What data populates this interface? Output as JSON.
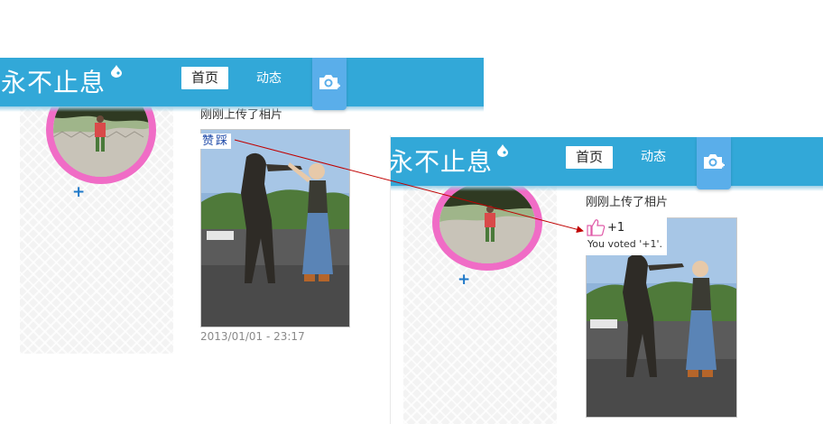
{
  "site": {
    "logo_text": "永不止息"
  },
  "nav": {
    "home_label": "首页",
    "activity_label": "动态"
  },
  "profile": {
    "add_symbol": "+"
  },
  "post": {
    "status_text": "刚刚上传了相片",
    "upvote_label": "赞",
    "downvote_label": "踩",
    "timestamp": "2013/01/01 - 23:17"
  },
  "vote_result": {
    "count_text": "+1",
    "message": "You voted '+1'."
  },
  "icons": {
    "logo_mark": "drop-icon",
    "camera": "camera-plus-icon",
    "thumb": "thumbs-up-icon",
    "arrow": "annotation-arrow"
  },
  "colors": {
    "nav_bar": "#32a8d8",
    "camera_button": "#5aaeea",
    "avatar_ring": "#f06cc6",
    "link": "#1f4aa8",
    "arrow": "#c00000"
  }
}
